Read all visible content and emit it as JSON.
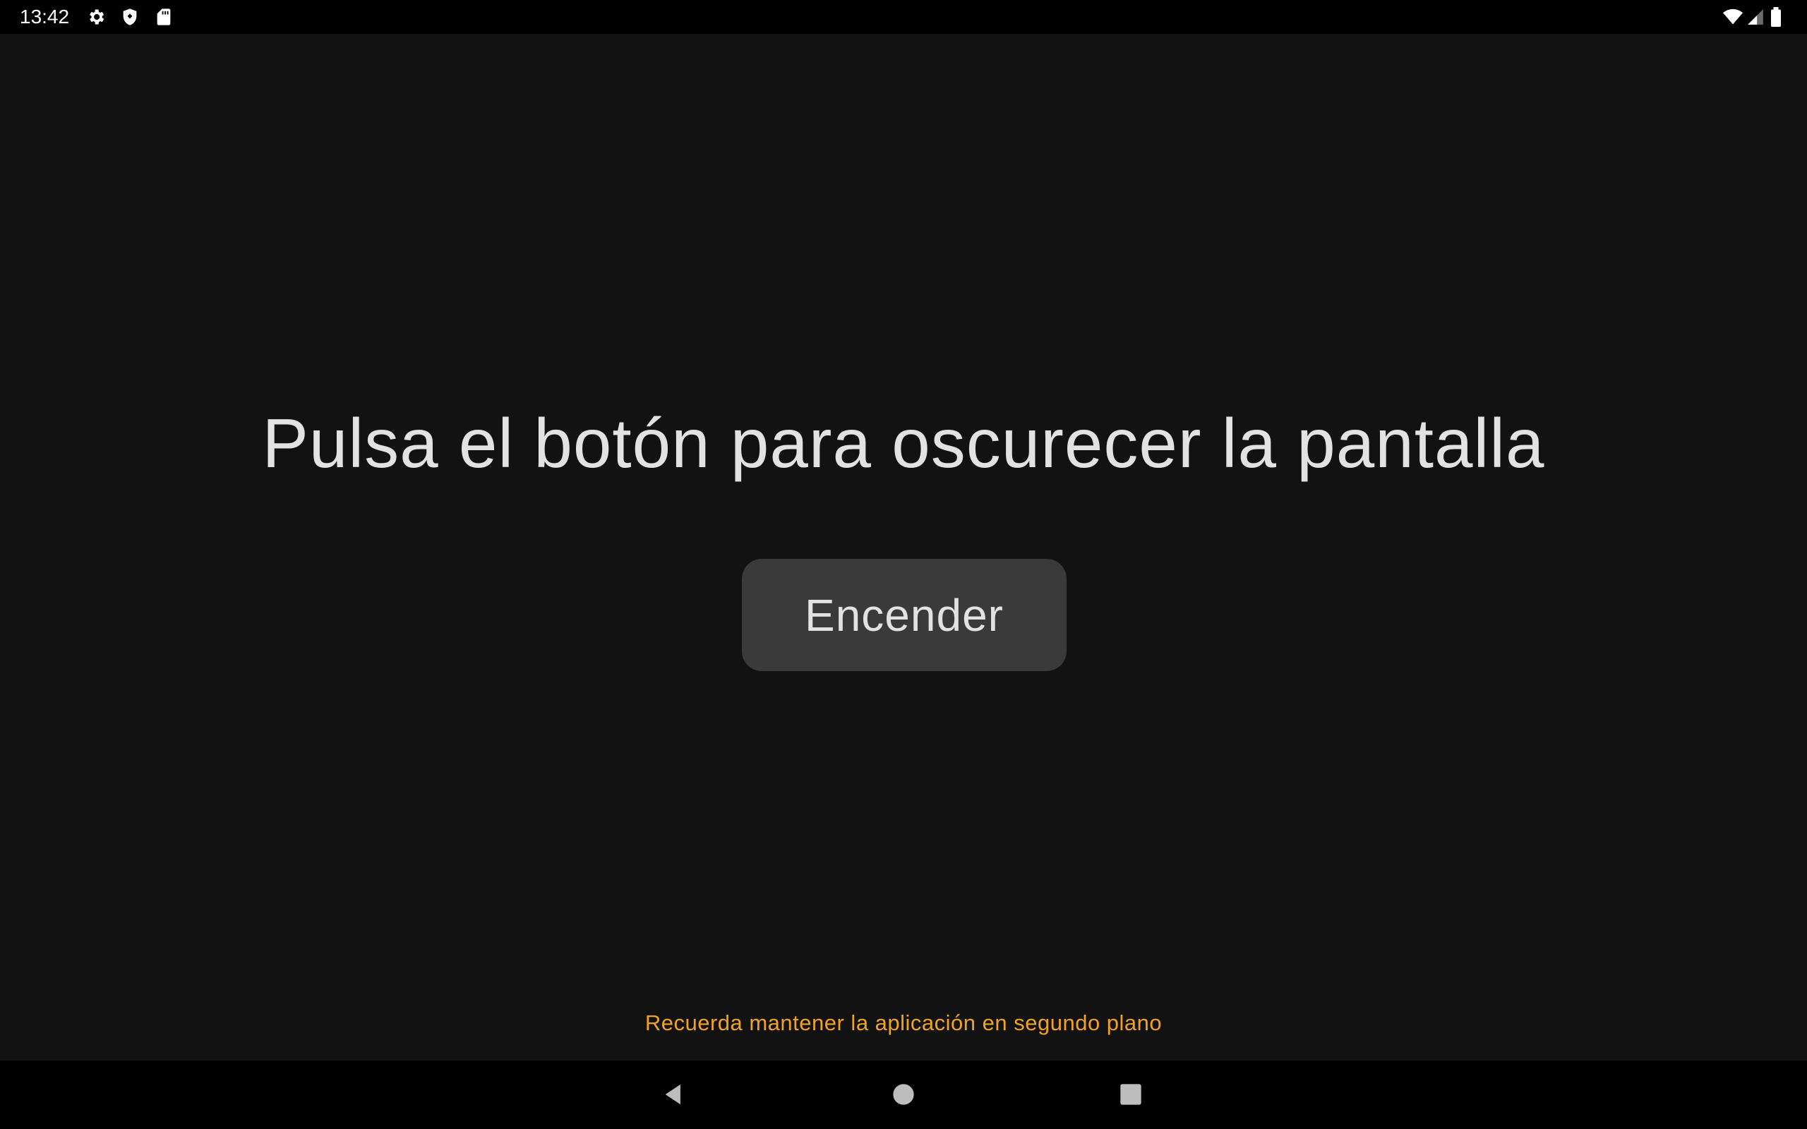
{
  "status_bar": {
    "time": "13:42",
    "left_icons": [
      "gear-icon",
      "shield-icon",
      "sd-card-icon"
    ],
    "right_icons": [
      "wifi-icon",
      "cell-signal-icon",
      "battery-icon"
    ]
  },
  "main": {
    "headline": "Pulsa el botón para oscurecer la pantalla",
    "button_label": "Encender",
    "reminder": "Recuerda mantener la aplicación en segundo plano"
  },
  "nav_bar": {
    "buttons": [
      "back-icon",
      "home-icon",
      "recents-icon"
    ]
  },
  "colors": {
    "background": "#121212",
    "button_bg": "#3a3a3a",
    "text": "#e2e2e2",
    "accent": "#f0a224"
  }
}
